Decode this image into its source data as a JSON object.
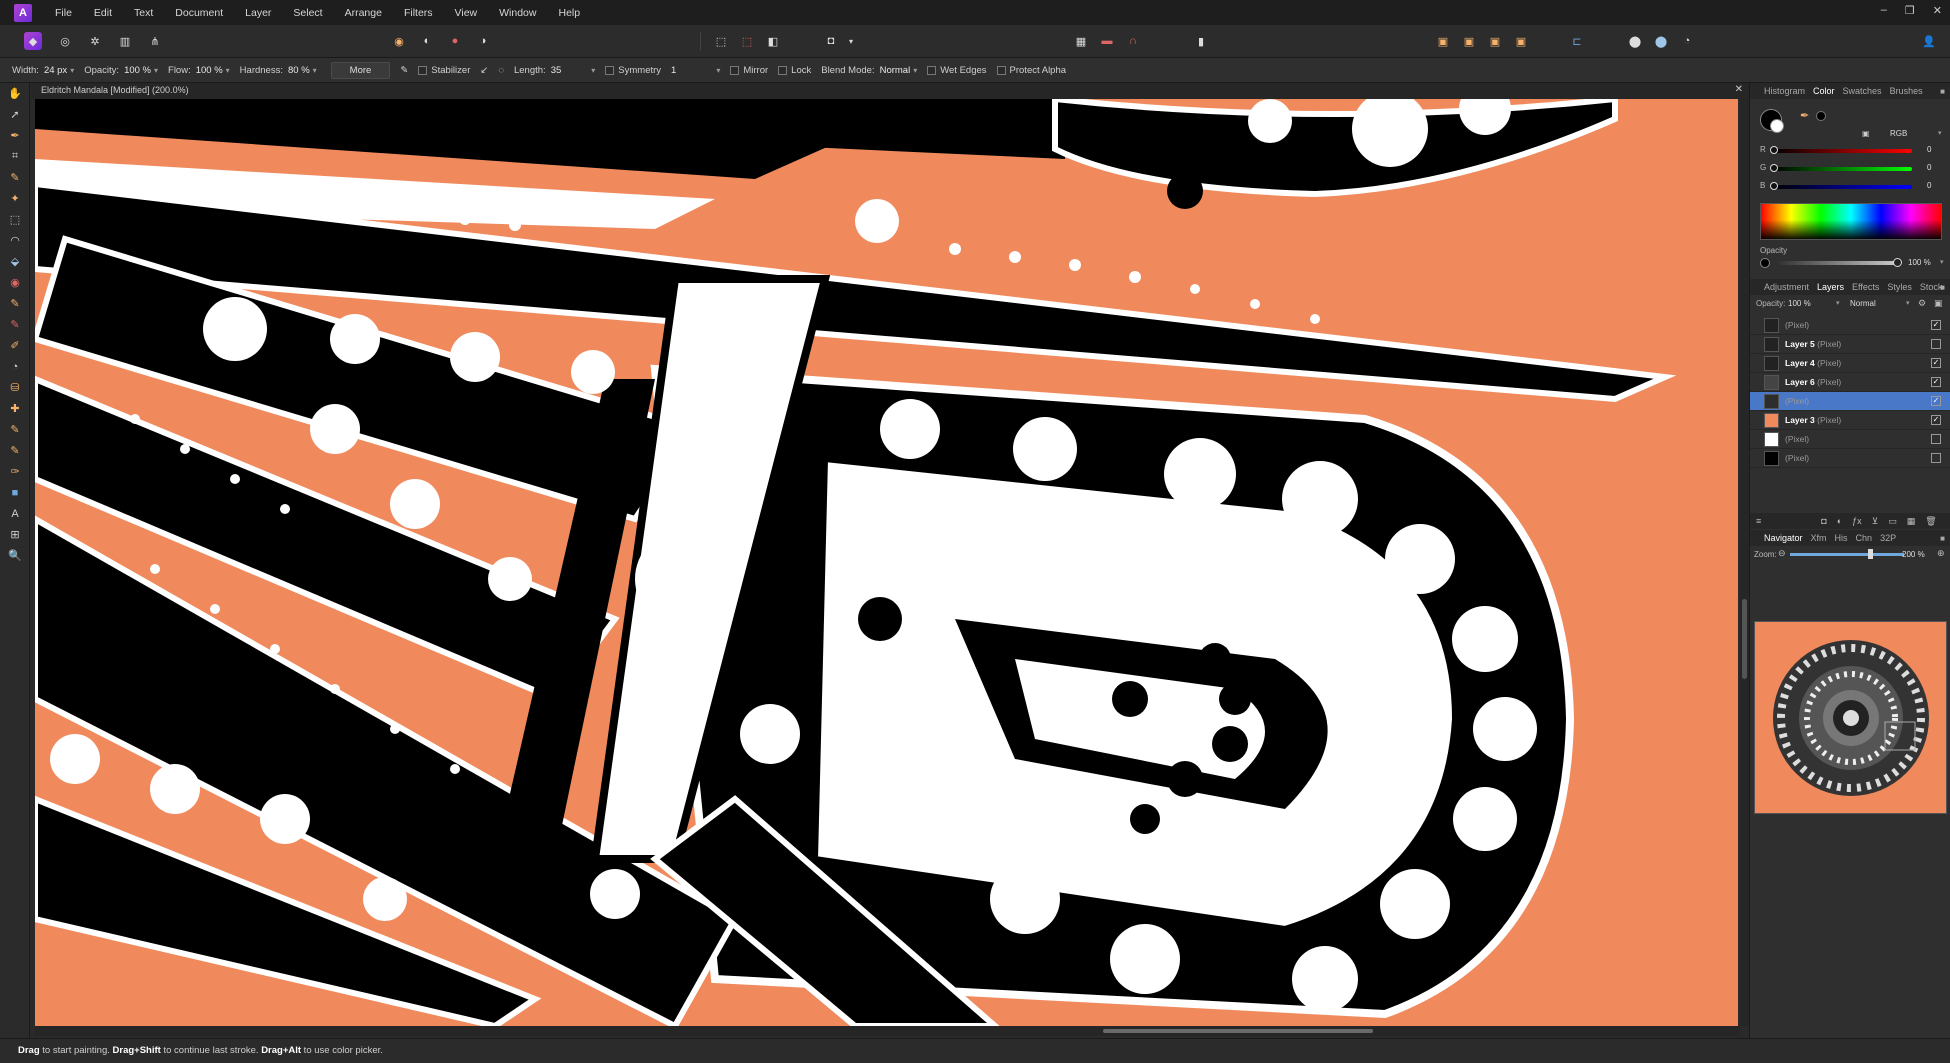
{
  "menubar": {
    "logo": "A",
    "items": [
      "File",
      "Edit",
      "Text",
      "Document",
      "Layer",
      "Select",
      "Arrange",
      "Filters",
      "View",
      "Window",
      "Help"
    ],
    "controls": [
      "–",
      "❐",
      "✕"
    ]
  },
  "context": {
    "width_label": "Width:",
    "width_value": "24 px",
    "opacity_label": "Opacity:",
    "opacity_value": "100 %",
    "flow_label": "Flow:",
    "flow_value": "100 %",
    "hardness_label": "Hardness:",
    "hardness_value": "80 %",
    "more_label": "More",
    "stabilizer_label": "Stabilizer",
    "length_label": "Length:",
    "length_value": "35",
    "symmetry_label": "Symmetry",
    "symmetry_value": "1",
    "mirror_label": "Mirror",
    "lock_label": "Lock",
    "blend_label": "Blend Mode:",
    "blend_value": "Normal",
    "wet_edges_label": "Wet Edges",
    "protect_alpha_label": "Protect Alpha"
  },
  "document": {
    "title": "Eldritch Mandala [Modified] (200.0%)",
    "close": "✕"
  },
  "status": {
    "t1": "Drag",
    "t2": " to start painting. ",
    "t3": "Drag+Shift",
    "t4": " to continue last stroke. ",
    "t5": "Drag+Alt",
    "t6": " to use color picker."
  },
  "color_panel": {
    "tabs": [
      "Histogram",
      "Color",
      "Swatches",
      "Brushes"
    ],
    "active_tab": "Color",
    "model": "RGB",
    "r_label": "R",
    "r_value": "0",
    "g_label": "G",
    "g_value": "0",
    "b_label": "B",
    "b_value": "0",
    "opacity_label": "Opacity",
    "opacity_value": "100 %"
  },
  "layers_panel": {
    "tabs": [
      "Adjustment",
      "Layers",
      "Effects",
      "Styles",
      "Stock"
    ],
    "active_tab": "Layers",
    "opacity_label": "Opacity:",
    "opacity_value": "100 %",
    "blend_value": "Normal",
    "layers": [
      {
        "name": "",
        "type": "(Pixel)",
        "checked": true,
        "thumb": "#222222",
        "selected": false
      },
      {
        "name": "Layer 5",
        "type": "(Pixel)",
        "checked": false,
        "thumb": "#222222",
        "selected": false
      },
      {
        "name": "Layer 4",
        "type": "(Pixel)",
        "checked": true,
        "thumb": "#222222",
        "selected": false
      },
      {
        "name": "Layer 6",
        "type": "(Pixel)",
        "checked": true,
        "thumb": "#444444",
        "selected": false
      },
      {
        "name": "",
        "type": "(Pixel)",
        "checked": true,
        "thumb": "#2d2d2d",
        "selected": true
      },
      {
        "name": "Layer 3",
        "type": "(Pixel)",
        "checked": true,
        "thumb": "#f08a5d",
        "selected": false
      },
      {
        "name": "",
        "type": "(Pixel)",
        "checked": false,
        "thumb": "#ffffff",
        "selected": false
      },
      {
        "name": "",
        "type": "(Pixel)",
        "checked": false,
        "thumb": "#000000",
        "selected": false
      }
    ]
  },
  "navigator_panel": {
    "tabs": [
      "Navigator",
      "Xfm",
      "His",
      "Chn",
      "32P"
    ],
    "active_tab": "Navigator",
    "zoom_label": "Zoom:",
    "zoom_value": "200 %"
  },
  "colors": {
    "canvas_bg": "#f08a5d",
    "selection": "#4a78c9"
  }
}
